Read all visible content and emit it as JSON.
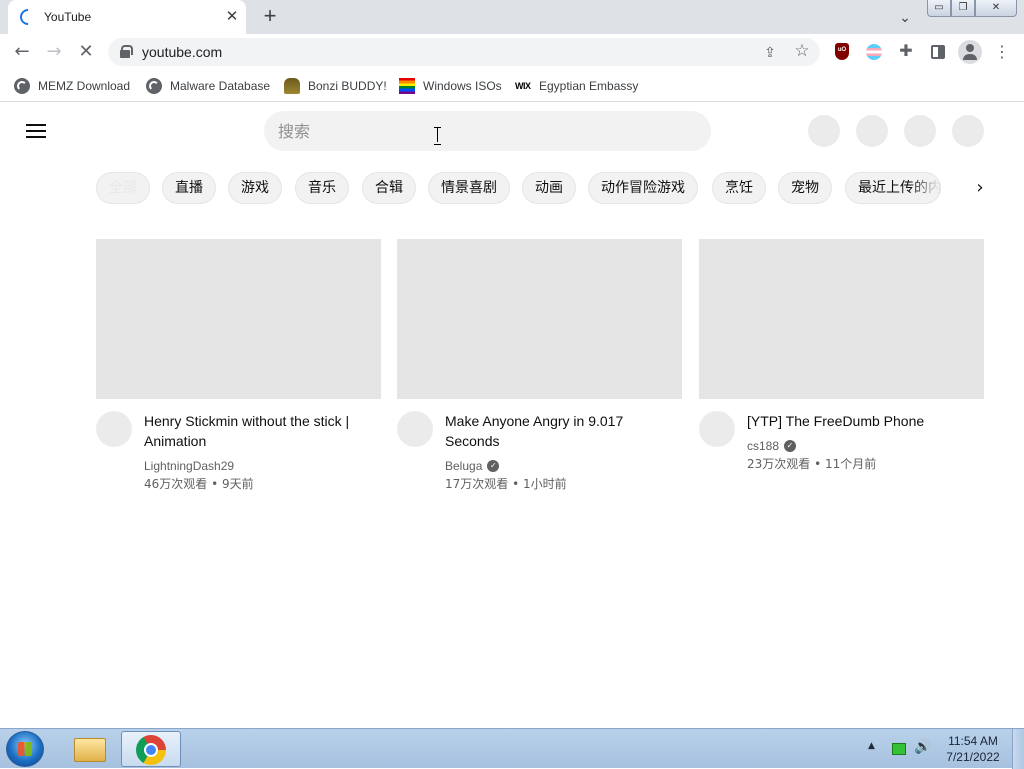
{
  "browser": {
    "tab_title": "YouTube",
    "tab_close": "✕",
    "new_tab": "+",
    "tab_search": "⌄",
    "window_buttons": [
      "▭",
      "❐",
      "✕"
    ],
    "nav": {
      "back": "←",
      "forward": "→",
      "reload": "✕"
    },
    "url": "youtube.com",
    "share": "⇪",
    "star": "☆",
    "puzzle": "✚",
    "menu": "⋮",
    "ublock_label": "uO"
  },
  "bookmarks": [
    {
      "label": "MEMZ Download",
      "icon": "globe-icon"
    },
    {
      "label": "Malware Database",
      "icon": "globe-icon"
    },
    {
      "label": "Bonzi BUDDY!",
      "icon": "bonzi-icon"
    },
    {
      "label": "Windows ISOs",
      "icon": "rainbow-flag-icon"
    },
    {
      "label": "Egyptian Embassy",
      "icon": "wix-icon",
      "icon_text": "WIX"
    }
  ],
  "youtube": {
    "search_placeholder": "搜索",
    "chips": [
      "全部",
      "直播",
      "游戏",
      "音乐",
      "合辑",
      "情景喜剧",
      "动画",
      "动作冒险游戏",
      "烹饪",
      "宠物",
      "最近上传的内"
    ],
    "chips_next": "›",
    "videos": [
      {
        "title": "Henry Stickmin without the stick | Animation",
        "channel": "LightningDash29",
        "verified": false,
        "meta": "46万次观看 • 9天前"
      },
      {
        "title": "Make Anyone Angry in 9.017 Seconds",
        "channel": "Beluga",
        "verified": true,
        "meta": "17万次观看 • 1小时前"
      },
      {
        "title": "[YTP] The FreeDumb Phone",
        "channel": "cs188",
        "verified": true,
        "meta": "23万次观看 • 11个月前"
      }
    ],
    "verified_glyph": "✓"
  },
  "taskbar": {
    "tray_arrow": "▲",
    "volume": "🔊",
    "time": "11:54 AM",
    "date": "7/21/2022"
  }
}
